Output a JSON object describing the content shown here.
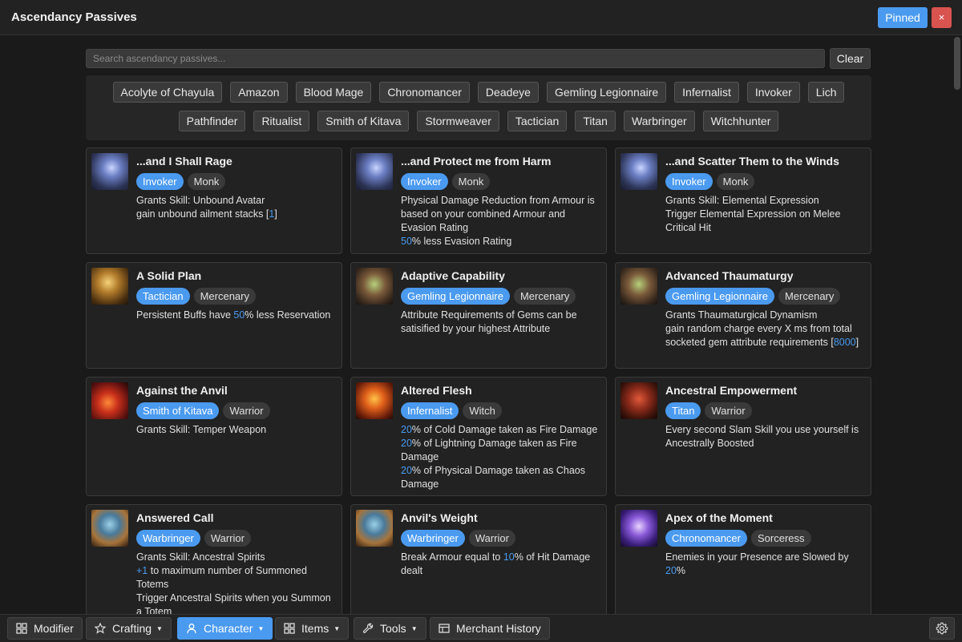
{
  "window": {
    "title": "Ascendancy Passives",
    "pinned_label": "Pinned",
    "close_label": "×"
  },
  "search": {
    "placeholder": "Search ascendancy passives...",
    "clear_label": "Clear"
  },
  "filters": {
    "row1": [
      "Acolyte of Chayula",
      "Amazon",
      "Blood Mage",
      "Chronomancer",
      "Deadeye",
      "Gemling Legionnaire",
      "Infernalist",
      "Invoker",
      "Lich"
    ],
    "row2": [
      "Pathfinder",
      "Ritualist",
      "Smith of Kitava",
      "Stormweaver",
      "Tactician",
      "Titan",
      "Warbringer",
      "Witchhunter"
    ]
  },
  "colors": {
    "accent": "#4a9af0",
    "close": "#d9534f",
    "card_bg": "#222222",
    "page_bg": "#1a1a1a"
  },
  "cards": [
    {
      "name": "...and I Shall Rage",
      "ascendancy": "Invoker",
      "class": "Monk",
      "icon": "invoker-portrait-icon",
      "lines": [
        [
          {
            "t": "Grants Skill: Unbound Avatar"
          }
        ],
        [
          {
            "t": "gain unbound ailment stacks ["
          },
          {
            "t": "1",
            "hl": true
          },
          {
            "t": "]"
          }
        ]
      ]
    },
    {
      "name": "...and Protect me from Harm",
      "ascendancy": "Invoker",
      "class": "Monk",
      "icon": "invoker-portrait-icon",
      "lines": [
        [
          {
            "t": "Physical Damage Reduction from Armour is based on your combined Armour and Evasion Rating"
          }
        ],
        [
          {
            "t": "50",
            "hl": true
          },
          {
            "t": "% less Evasion Rating"
          }
        ]
      ]
    },
    {
      "name": "...and Scatter Them to the Winds",
      "ascendancy": "Invoker",
      "class": "Monk",
      "icon": "invoker-portrait-icon",
      "lines": [
        [
          {
            "t": "Grants Skill: Elemental Expression"
          }
        ],
        [
          {
            "t": "Trigger Elemental Expression on Melee Critical Hit"
          }
        ]
      ]
    },
    {
      "name": "A Solid Plan",
      "ascendancy": "Tactician",
      "class": "Mercenary",
      "icon": "tactician-portrait-icon",
      "lines": [
        [
          {
            "t": "Persistent Buffs have "
          },
          {
            "t": "50",
            "hl": true
          },
          {
            "t": "% less Reservation"
          }
        ]
      ]
    },
    {
      "name": "Adaptive Capability",
      "ascendancy": "Gemling Legionnaire",
      "class": "Mercenary",
      "icon": "gemling-portrait-icon",
      "lines": [
        [
          {
            "t": "Attribute Requirements of Gems can be satisified by your highest Attribute"
          }
        ]
      ]
    },
    {
      "name": "Advanced Thaumaturgy",
      "ascendancy": "Gemling Legionnaire",
      "class": "Mercenary",
      "icon": "gemling-portrait-icon",
      "lines": [
        [
          {
            "t": "Grants Thaumaturgical Dynamism"
          }
        ],
        [
          {
            "t": "gain random charge every X ms from total socketed gem attribute requirements ["
          },
          {
            "t": "8000",
            "hl": true
          },
          {
            "t": "]"
          }
        ]
      ]
    },
    {
      "name": "Against the Anvil",
      "ascendancy": "Smith of Kitava",
      "class": "Warrior",
      "icon": "smith-portrait-icon",
      "lines": [
        [
          {
            "t": "Grants Skill: Temper Weapon"
          }
        ]
      ]
    },
    {
      "name": "Altered Flesh",
      "ascendancy": "Infernalist",
      "class": "Witch",
      "icon": "infernalist-portrait-icon",
      "lines": [
        [
          {
            "t": "20",
            "hl": true
          },
          {
            "t": "% of Cold Damage taken as Fire Damage"
          }
        ],
        [
          {
            "t": "20",
            "hl": true
          },
          {
            "t": "% of Lightning Damage taken as Fire Damage"
          }
        ],
        [
          {
            "t": "20",
            "hl": true
          },
          {
            "t": "% of Physical Damage taken as Chaos Damage"
          }
        ]
      ]
    },
    {
      "name": "Ancestral Empowerment",
      "ascendancy": "Titan",
      "class": "Warrior",
      "icon": "titan-portrait-icon",
      "lines": [
        [
          {
            "t": "Every second Slam Skill you use yourself is Ancestrally Boosted"
          }
        ]
      ]
    },
    {
      "name": "Answered Call",
      "ascendancy": "Warbringer",
      "class": "Warrior",
      "icon": "warbringer-portrait-icon",
      "lines": [
        [
          {
            "t": "Grants Skill: Ancestral Spirits"
          }
        ],
        [
          {
            "t": "+1",
            "hl": true
          },
          {
            "t": " to maximum number of Summoned Totems"
          }
        ],
        [
          {
            "t": "Trigger Ancestral Spirits when you Summon a Totem"
          }
        ]
      ]
    },
    {
      "name": "Anvil's Weight",
      "ascendancy": "Warbringer",
      "class": "Warrior",
      "icon": "warbringer-portrait-icon",
      "lines": [
        [
          {
            "t": "Break Armour equal to "
          },
          {
            "t": "10",
            "hl": true
          },
          {
            "t": "% of Hit Damage dealt"
          }
        ]
      ]
    },
    {
      "name": "Apex of the Moment",
      "ascendancy": "Chronomancer",
      "class": "Sorceress",
      "icon": "chronomancer-portrait-icon",
      "lines": [
        [
          {
            "t": "Enemies in your Presence are Slowed by "
          },
          {
            "t": "20",
            "hl": true
          },
          {
            "t": "%"
          }
        ]
      ]
    }
  ],
  "bottombar": {
    "modifier": "Modifier",
    "crafting": "Crafting",
    "character": "Character",
    "items": "Items",
    "tools": "Tools",
    "merchant_history": "Merchant History",
    "caret": "▼"
  }
}
